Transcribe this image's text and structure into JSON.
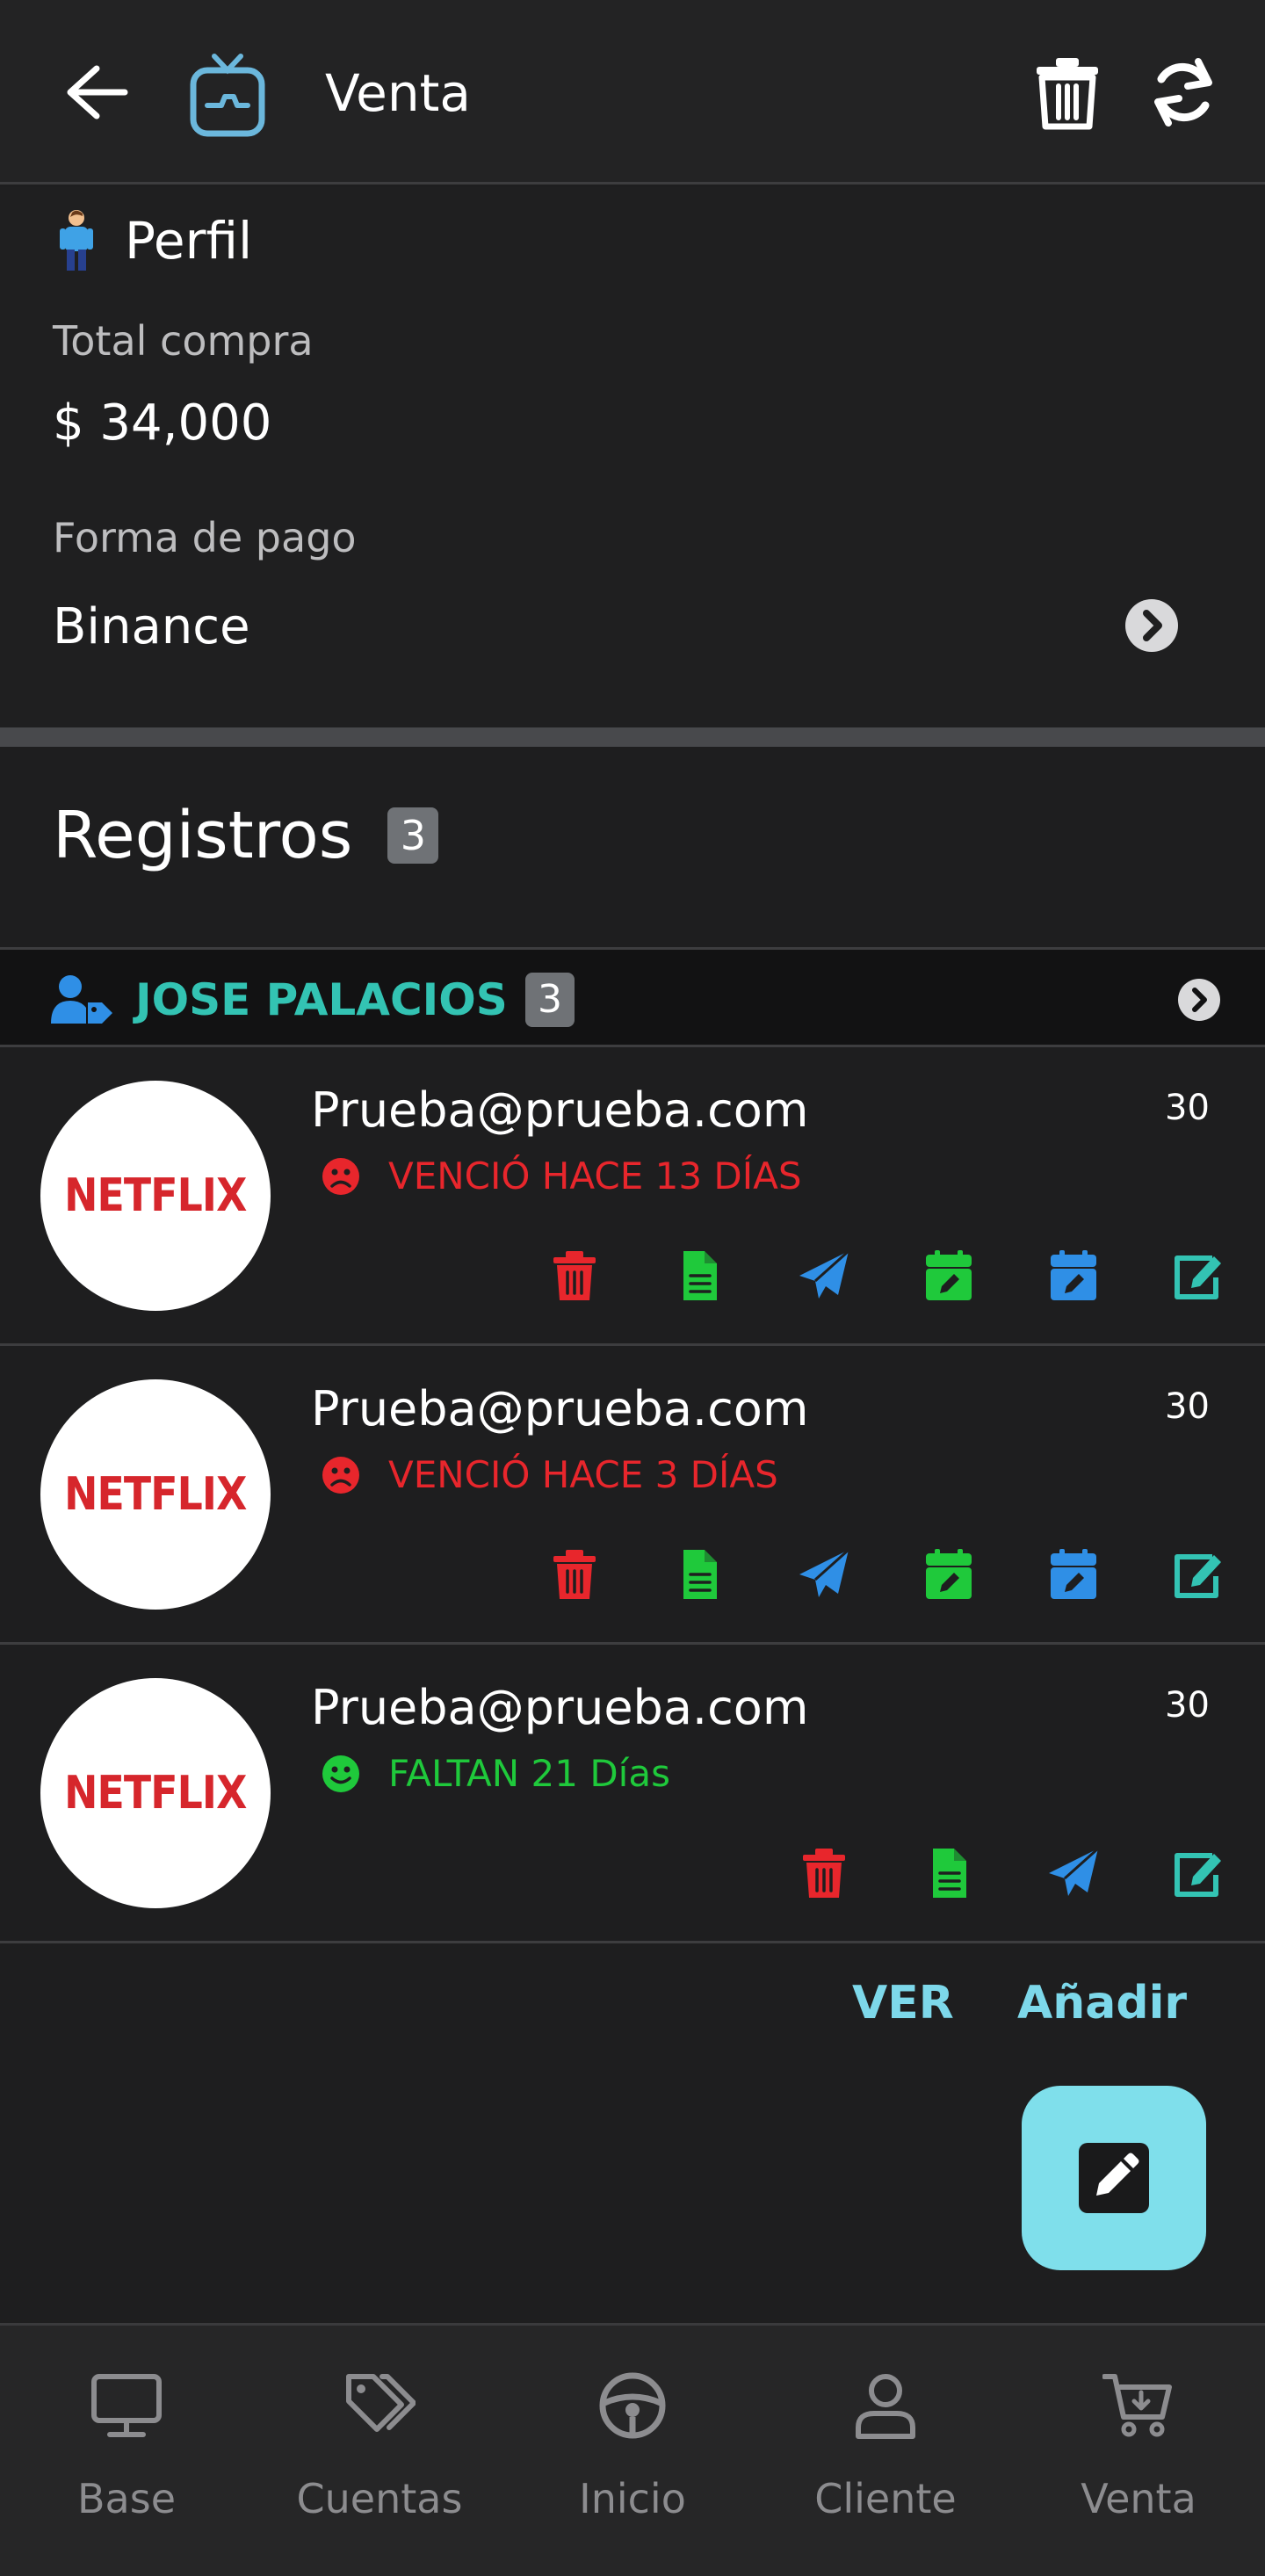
{
  "app_bar": {
    "title": "Venta",
    "icons": [
      "arrow-left-icon",
      "tv-icon",
      "trash-icon",
      "sync-icon"
    ]
  },
  "sale": {
    "profile_label": "Perfil",
    "total_label": "Total compra",
    "total_value": "$ 34,000",
    "payment_label": "Forma de pago",
    "payment_value": "Binance"
  },
  "records": {
    "title": "Registros",
    "count": "3",
    "client": {
      "name": "JOSE PALACIOS",
      "count": "3"
    },
    "items": [
      {
        "logo_text": "NETFLIX",
        "email": "Prueba@prueba.com",
        "days": "30",
        "status": "VENCIÓ HACE 13 DÍAS",
        "status_kind": "expired",
        "actions": [
          "trash-icon",
          "file-icon",
          "send-icon",
          "calendar-edit-icon",
          "calendar-edit-icon",
          "edit-icon"
        ]
      },
      {
        "logo_text": "NETFLIX",
        "email": "Prueba@prueba.com",
        "days": "30",
        "status": "VENCIÓ HACE 3 DÍAS",
        "status_kind": "expired",
        "actions": [
          "trash-icon",
          "file-icon",
          "send-icon",
          "calendar-edit-icon",
          "calendar-edit-icon",
          "edit-icon"
        ]
      },
      {
        "logo_text": "NETFLIX",
        "email": "Prueba@prueba.com",
        "days": "30",
        "status": "FALTAN 21 Días",
        "status_kind": "active",
        "actions": [
          "trash-icon",
          "file-icon",
          "send-icon",
          "edit-icon"
        ]
      }
    ],
    "ver_label": "VER",
    "add_label": "Añadir"
  },
  "bottom_nav": [
    {
      "label": "Base",
      "icon": "monitor-icon"
    },
    {
      "label": "Cuentas",
      "icon": "tags-icon"
    },
    {
      "label": "Inicio",
      "icon": "steering-wheel-icon"
    },
    {
      "label": "Cliente",
      "icon": "user-icon"
    },
    {
      "label": "Venta",
      "icon": "cart-icon"
    }
  ],
  "colors": {
    "background": "#1e1e1f",
    "accent_teal": "#33c3b3",
    "link": "#7dd8ea",
    "fab": "#7fdfeb",
    "red": "#e8262c",
    "green": "#1fc93b",
    "blue": "#2f8fe6"
  }
}
